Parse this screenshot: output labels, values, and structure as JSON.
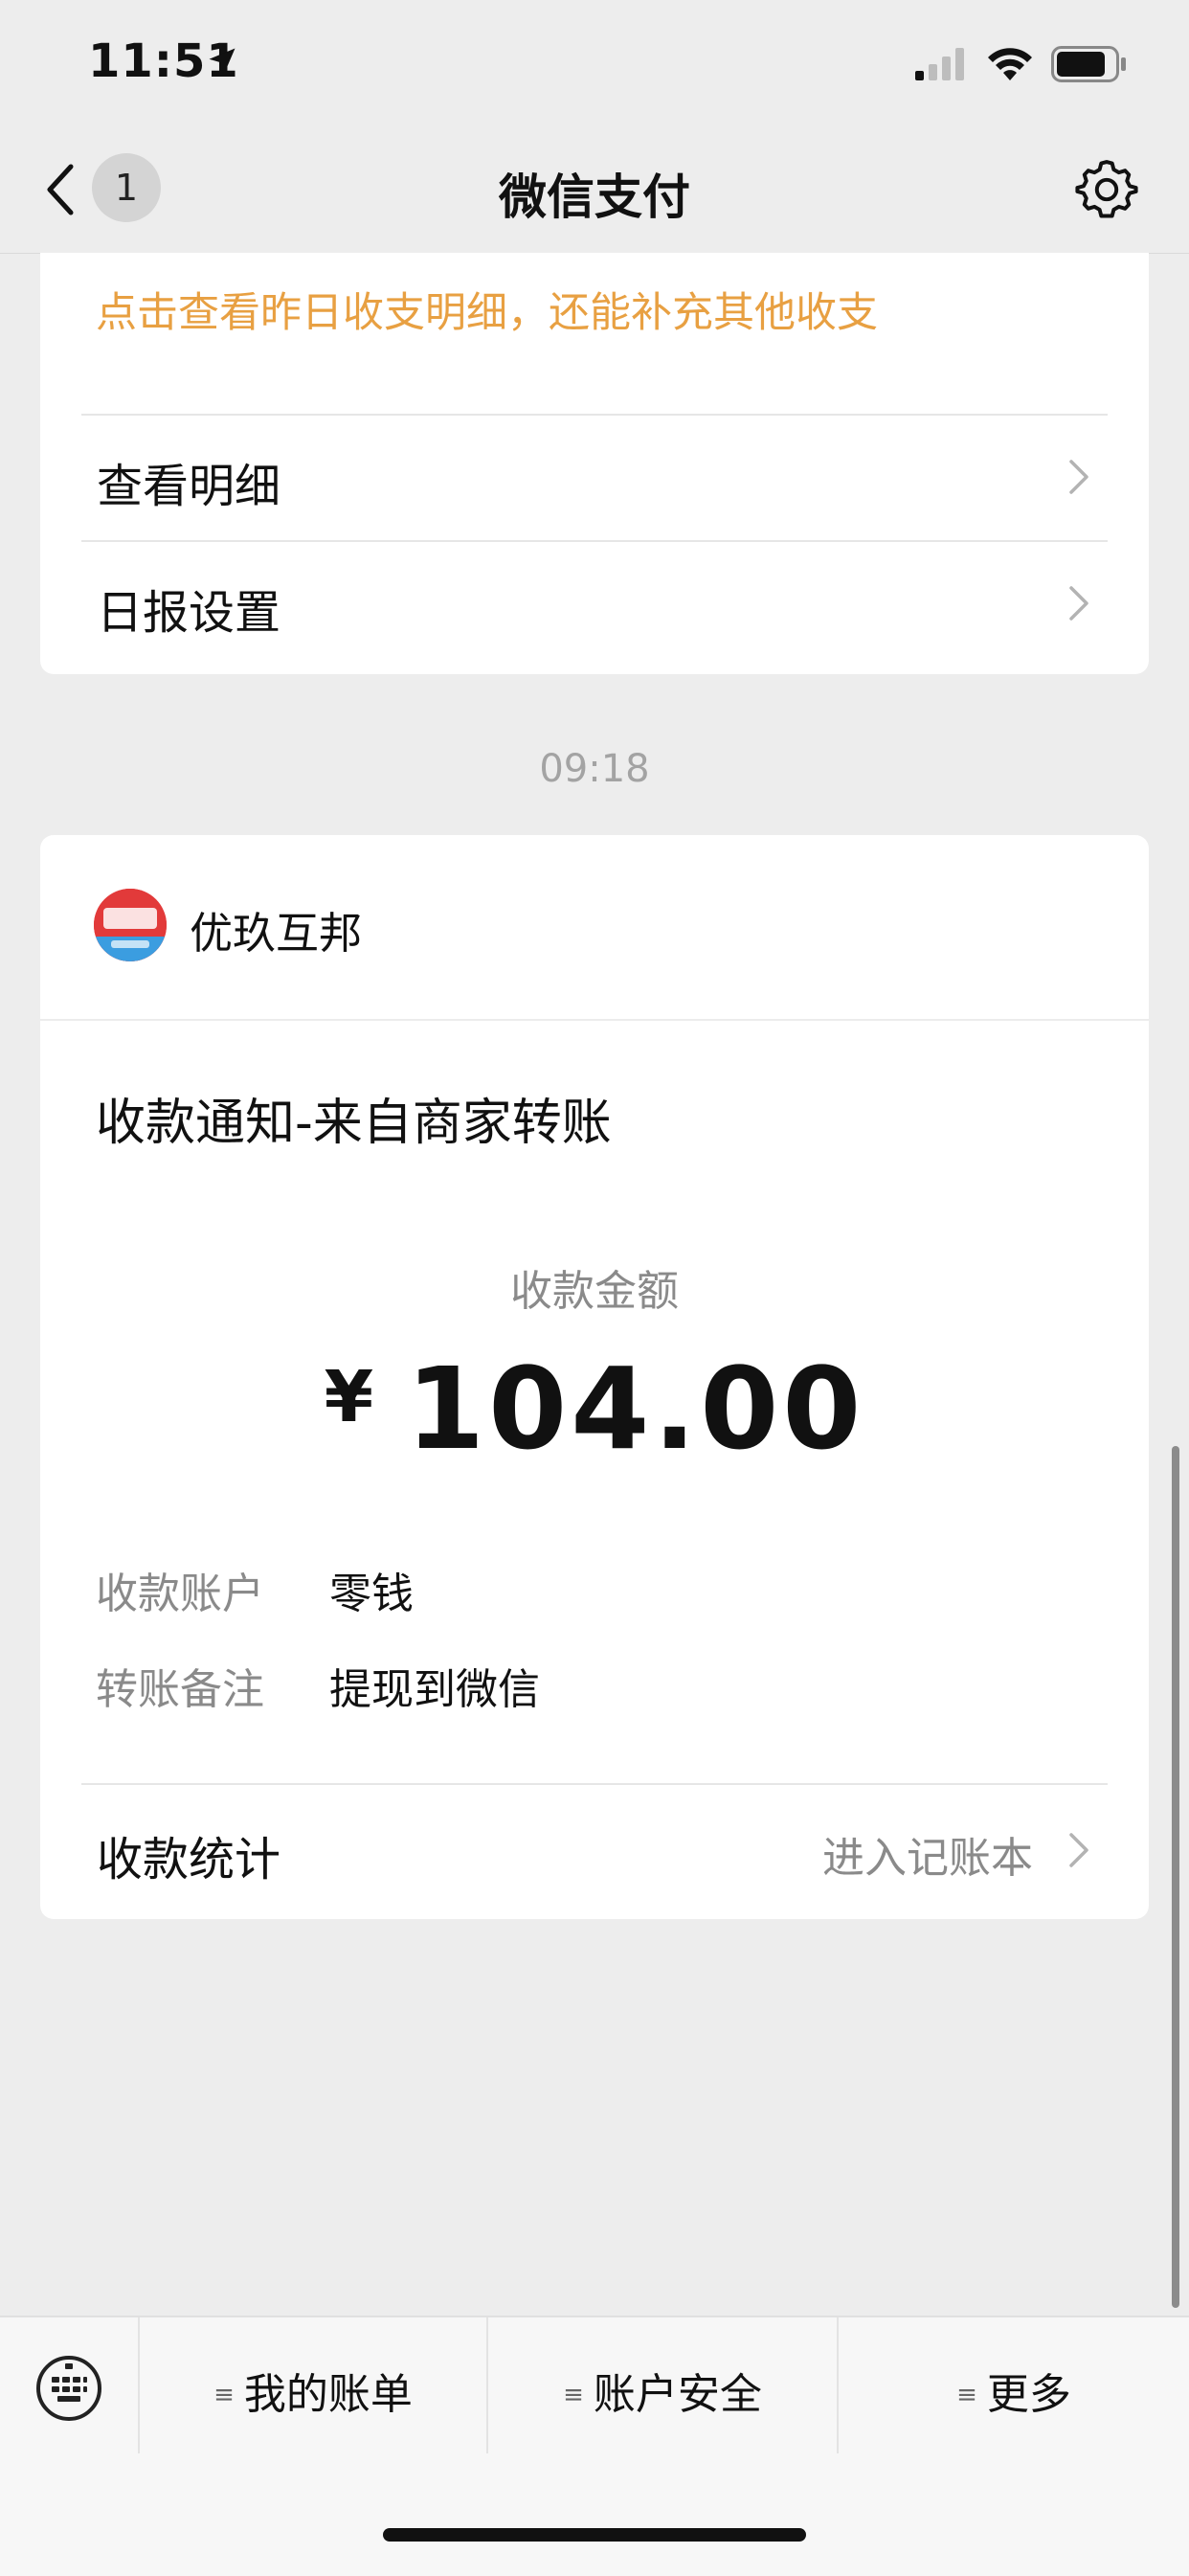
{
  "status_bar": {
    "time": "11:51"
  },
  "nav": {
    "back_badge": "1",
    "title": "微信支付"
  },
  "daily_report": {
    "hint": "点击查看昨日收支明细，还能补充其他收支",
    "rows": [
      {
        "label": "查看明细"
      },
      {
        "label": "日报设置"
      }
    ]
  },
  "timestamp": "09:18",
  "message": {
    "merchant_name": "优玖互邦",
    "title": "收款通知-来自商家转账",
    "amount_label": "收款金额",
    "currency": "¥",
    "amount": "104.00",
    "details": [
      {
        "label": "收款账户",
        "value": "零钱"
      },
      {
        "label": "转账备注",
        "value": "提现到微信"
      }
    ],
    "stats_label": "收款统计",
    "stats_link": "进入记账本"
  },
  "bottom_menu": {
    "items": [
      {
        "label": "我的账单"
      },
      {
        "label": "账户安全"
      },
      {
        "label": "更多"
      }
    ]
  },
  "colors": {
    "accent_orange": "#e8a042",
    "background": "#ededed"
  }
}
